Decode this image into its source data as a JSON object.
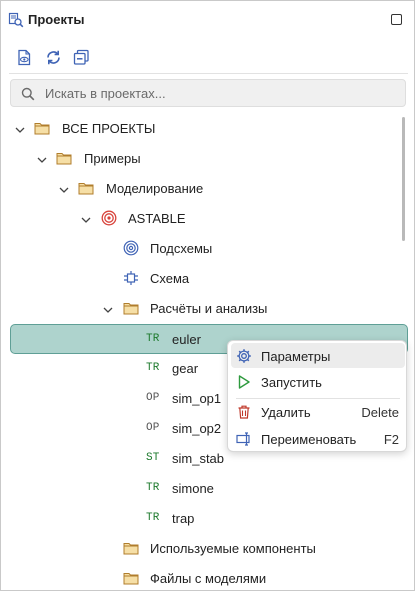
{
  "header": {
    "title": "Проекты"
  },
  "search": {
    "placeholder": "Искать в проектах..."
  },
  "tree": {
    "root": "ВСЕ ПРОЕКТЫ",
    "examples": "Примеры",
    "modeling": "Моделирование",
    "project": "ASTABLE",
    "subcircuits": "Подсхемы",
    "schematic": "Схема",
    "analyses": "Расчёты и анализы",
    "items": [
      {
        "tag": "TR",
        "label": "euler"
      },
      {
        "tag": "TR",
        "label": "gear"
      },
      {
        "tag": "OP",
        "label": "sim_op1"
      },
      {
        "tag": "OP",
        "label": "sim_op2"
      },
      {
        "tag": "ST",
        "label": "sim_stab"
      },
      {
        "tag": "TR",
        "label": "simone"
      },
      {
        "tag": "TR",
        "label": "trap"
      }
    ],
    "used_components": "Используемые компоненты",
    "model_files": "Файлы с моделями"
  },
  "context_menu": {
    "params": "Параметры",
    "run": "Запустить",
    "delete": "Удалить",
    "delete_shortcut": "Delete",
    "rename": "Переименовать",
    "rename_shortcut": "F2"
  },
  "colors": {
    "selection": "#aed3cd",
    "folder": "#e9c77a",
    "project": "#d8433b",
    "tag_green": "#1d7a2d"
  }
}
